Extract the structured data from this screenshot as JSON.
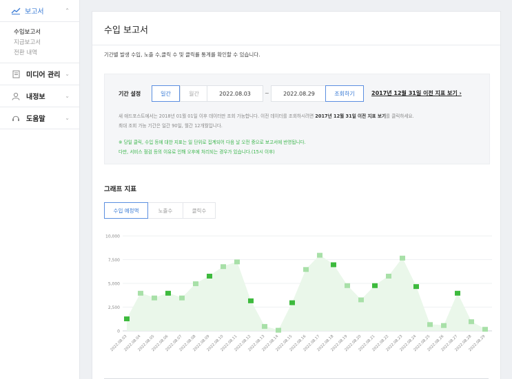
{
  "sidebar": {
    "report": {
      "label": "보고서"
    },
    "sub_items": [
      {
        "label": "수입보고서",
        "active": true
      },
      {
        "label": "지급보고서",
        "active": false
      },
      {
        "label": "전환 내역",
        "active": false
      }
    ],
    "items": [
      {
        "label": "미디어 관리"
      },
      {
        "label": "내정보"
      },
      {
        "label": "도움말"
      }
    ]
  },
  "main": {
    "title": "수입 보고서",
    "description": "기간별 발생 수입, 노출 수,클릭 수 및 클릭률 통계를 확인할 수 있습니다.",
    "filter": {
      "label": "기간 설정",
      "period_options": [
        "일간",
        "월간"
      ],
      "selected_period": "일간",
      "start_date": "2022.08.03",
      "separator": "~",
      "end_date": "2022.08.29",
      "lookup_button": "조회하기",
      "prev_link": "2017년 12월 31일 이전 지표 보기",
      "notes": {
        "line1_a": "새 애드포스트에서는 2018년 01월 01일 이후 데이터만 조회 가능합니다. 이전 데이터를 조회하시려면 ",
        "line1_b": "2017년 12월 31일 이전 지표 보기",
        "line1_c": "를 클릭하세요.",
        "line2": "최대 조회 가능 기간은 일간 90일, 월간 12개월입니다.",
        "line3": "※ 당일 클릭, 수입 등에 대한 지표는 일 단위로 집계되어 다음 날 오전 중으로 보고서에 반영됩니다.",
        "line4": "다만, 서비스 점검 등의 이유로 인해 오후에 처리되는 경우가 있습니다.(15시 이후)"
      }
    },
    "graph": {
      "section_title": "그래프 지표",
      "tabs": [
        "수입 예정액",
        "노출수",
        "클릭수"
      ],
      "active_tab": "수입 예정액"
    }
  },
  "colors": {
    "accent": "#3a7bd5",
    "note_green": "#39b54a",
    "bar_light": "#eaf7ea",
    "bar_mid": "#a8e0a8",
    "bar_dark": "#3dba3d"
  },
  "chart_data": {
    "type": "area",
    "ylim": [
      0,
      10000
    ],
    "yticks": [
      "0",
      "2,500",
      "5,000",
      "7,500",
      "10,000"
    ],
    "categories": [
      "2022.08.03",
      "2022.08.04",
      "2022.08.05",
      "2022.08.06",
      "2022.08.07",
      "2022.08.08",
      "2022.08.09",
      "2022.08.10",
      "2022.08.11",
      "2022.08.12",
      "2022.08.13",
      "2022.08.14",
      "2022.08.15",
      "2022.08.16",
      "2022.08.17",
      "2022.08.18",
      "2022.08.19",
      "2022.08.20",
      "2022.08.21",
      "2022.08.22",
      "2022.08.23",
      "2022.08.24",
      "2022.08.25",
      "2022.08.26",
      "2022.08.27",
      "2022.08.28",
      "2022.08.29"
    ],
    "series": [
      {
        "values": [
          1300,
          4000,
          3500,
          4000,
          3500,
          5000,
          5800,
          6800,
          7300,
          3200,
          500,
          100,
          3000,
          6500,
          8000,
          7000,
          4800,
          3300,
          4800,
          5800,
          7700,
          4700,
          700,
          600,
          4000,
          1000,
          200
        ]
      }
    ]
  }
}
